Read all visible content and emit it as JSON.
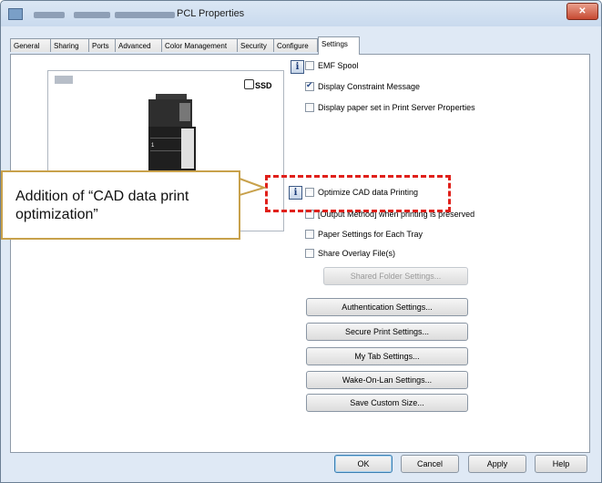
{
  "window": {
    "title": "PCL Properties",
    "close_glyph": "✕"
  },
  "tabs": [
    {
      "label": "General"
    },
    {
      "label": "Sharing"
    },
    {
      "label": "Ports"
    },
    {
      "label": "Advanced"
    },
    {
      "label": "Color Management"
    },
    {
      "label": "Security"
    },
    {
      "label": "Configure"
    },
    {
      "label": "Settings",
      "active": true
    }
  ],
  "printer_preview": {
    "ssd_label": "SSD",
    "tray_number": "1"
  },
  "options": {
    "emf_spool": {
      "label": "EMF Spool",
      "checked": false
    },
    "display_constraint": {
      "label": "Display Constraint Message",
      "checked": true
    },
    "display_paper_set": {
      "label": "Display paper set in Print Server Properties",
      "checked": false
    },
    "optimize_cad": {
      "label": "Optimize CAD data Printing",
      "checked": false
    },
    "output_method": {
      "label": "[Output Method] when printing is preserved",
      "checked": false
    },
    "paper_settings_tray": {
      "label": "Paper Settings for Each Tray",
      "checked": false
    },
    "share_overlay": {
      "label": "Share Overlay File(s)",
      "checked": false
    }
  },
  "info_icon_glyph": "i",
  "buttons": {
    "shared_folder": "Shared Folder Settings...",
    "authentication": "Authentication Settings...",
    "secure_print": "Secure Print Settings...",
    "my_tab": "My Tab Settings...",
    "wake_on_lan": "Wake-On-Lan Settings...",
    "save_custom_size": "Save Custom Size..."
  },
  "footer": {
    "ok": "OK",
    "cancel": "Cancel",
    "apply": "Apply",
    "help": "Help"
  },
  "callout": {
    "text": "Addition of “CAD data print optimization”"
  },
  "colors": {
    "highlight_dash": "#e0201a",
    "callout_border": "#c8a14b"
  }
}
